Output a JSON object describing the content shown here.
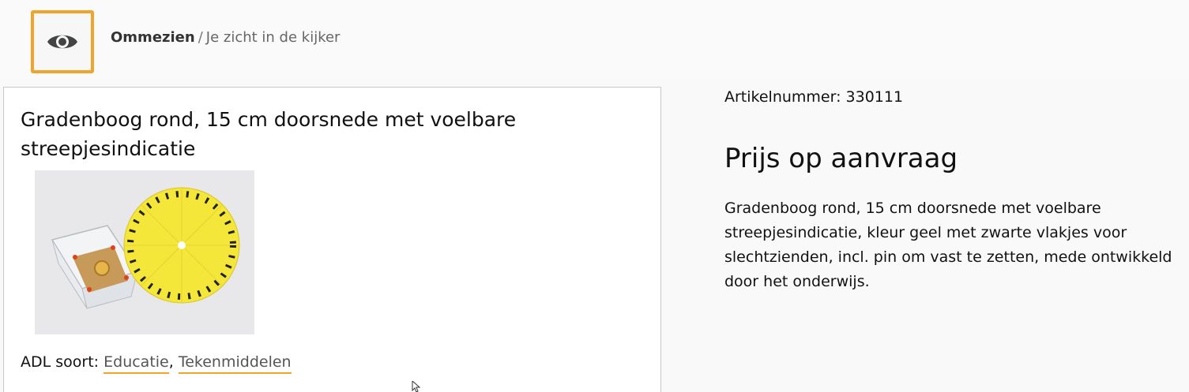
{
  "breadcrumb": {
    "home": "Ommezien",
    "separator": "/",
    "current": "Je zicht in de kijker"
  },
  "logo": {
    "icon": "eye-icon",
    "border_color": "#f0a52a"
  },
  "product": {
    "title": "Gradenboog rond, 15 cm doorsnede met voelbare streepjesindicatie",
    "image_alt": "Gradenboog rond, 15 cm doorsnede",
    "adl_label": "ADL soort:",
    "categories": [
      "Educatie",
      "Tekenmiddelen"
    ],
    "category_separator": ","
  },
  "details": {
    "article_number": "Artikelnummer: 330111",
    "price": "Prijs op aanvraag",
    "description": "Gradenboog rond, 15 cm doorsnede met voelbare streepjesindicatie, kleur geel met zwarte vlakjes voor slechtzienden, incl. pin om vast te zetten, mede ontwikkeld door het onderwijs."
  },
  "colors": {
    "accent": "#f0a52a",
    "protractor": "#f5e63a"
  }
}
